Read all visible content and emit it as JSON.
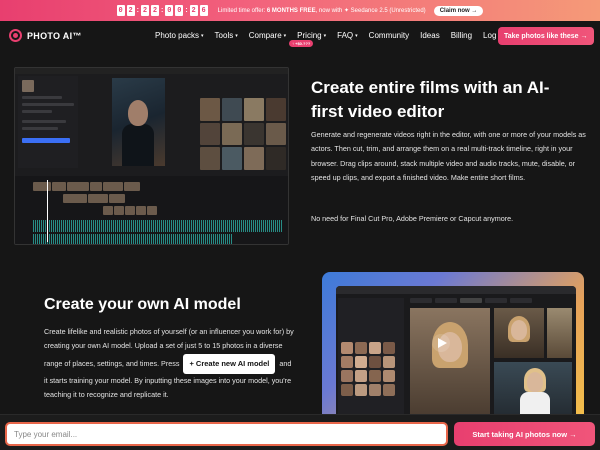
{
  "promo": {
    "countdown": [
      "0",
      "2",
      "2",
      "2",
      "0",
      "0",
      "2",
      "6"
    ],
    "text_prefix": "Limited time offer:",
    "text_bold": "6 MONTHS FREE",
    "text_suffix": ", now with",
    "text_product": "Seedance 2.5 (Unrestricted)",
    "claim_label": "Claim now →"
  },
  "brand": {
    "logo_text": "PHOTO AI™",
    "accent": "#e83f6f"
  },
  "nav": {
    "items": [
      {
        "label": "Photo packs",
        "dropdown": true
      },
      {
        "label": "Tools",
        "dropdown": true
      },
      {
        "label": "Compare",
        "dropdown": true
      },
      {
        "label": "Pricing",
        "dropdown": true
      },
      {
        "label": "FAQ",
        "dropdown": true
      },
      {
        "label": "Community",
        "dropdown": false
      },
      {
        "label": "Ideas",
        "dropdown": false
      },
      {
        "label": "Billing",
        "dropdown": false
      },
      {
        "label": "Log in",
        "dropdown": false
      }
    ],
    "pricing_badge": "↑ +$0.???",
    "cta_label": "Take photos like these →"
  },
  "section1": {
    "heading": "Create entire films with an AI-first video editor",
    "body": "Generate and regenerate videos right in the editor, with one or more of your models as actors. Then cut, trim, and arrange them on a real multi-track timeline, right in your browser. Drag clips around, stack multiple video and audio tracks, mute, disable, or speed up clips, and export a finished video. Make entire short films.",
    "note": "No need for Final Cut Pro, Adobe Premiere or Capcut anymore."
  },
  "section2": {
    "heading": "Create your own AI model",
    "body_before": "Create lifelike and realistic photos of yourself (or an influencer you work for) by creating your own AI model. Upload a set of just 5 to 15 photos in a diverse range of places, settings, and times. Press",
    "inline_button": "+ Create new AI model",
    "body_after": "and it starts training your model. By inputting these images into your model, you're teaching it to recognize and replicate it."
  },
  "signup": {
    "placeholder": "Type your email...",
    "cta_label": "Start taking AI photos now →"
  }
}
